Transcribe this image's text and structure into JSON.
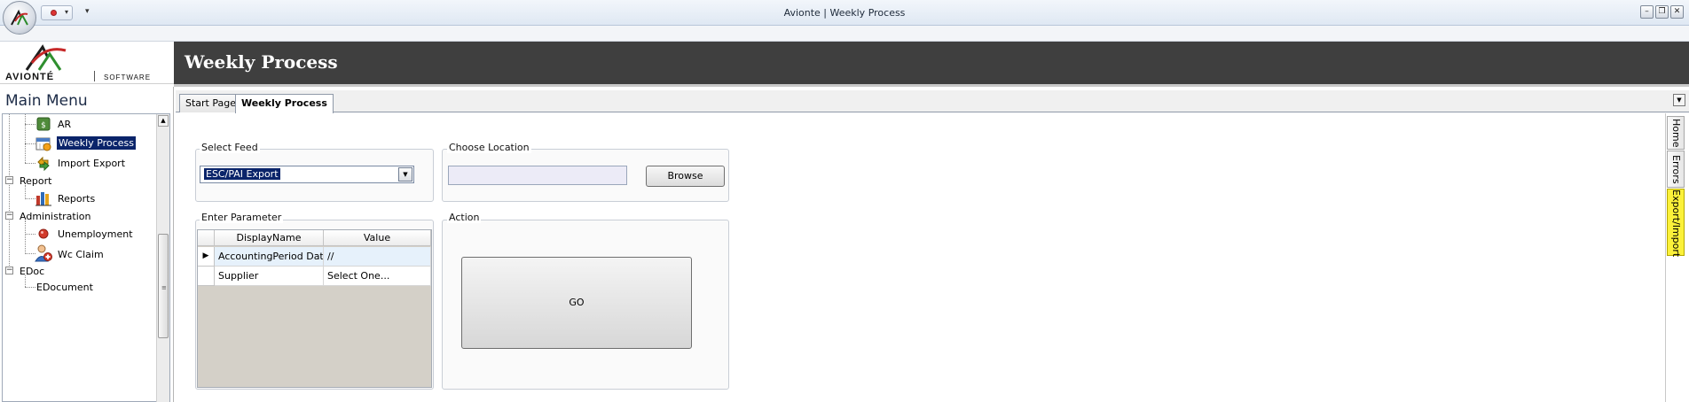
{
  "window": {
    "title": "Avionte | Weekly Process",
    "qat_more": "▾",
    "buttons": {
      "minimize": "–",
      "restore": "❐",
      "close": "✕"
    }
  },
  "brand": {
    "name": "AVIONTÉ",
    "sub": "SOFTWARE"
  },
  "header": {
    "title": "Weekly Process"
  },
  "main_menu": {
    "title": "Main Menu",
    "groups": [
      {
        "label": "Report",
        "expander": "−"
      },
      {
        "label": "Administration",
        "expander": "−"
      },
      {
        "label": "EDoc",
        "expander": "−"
      }
    ],
    "items": [
      {
        "label": "AR"
      },
      {
        "label": "Weekly Process",
        "selected": true
      },
      {
        "label": "Import Export"
      },
      {
        "label": "Reports"
      },
      {
        "label": "Unemployment"
      },
      {
        "label": "Wc Claim"
      },
      {
        "label": "EDocument"
      }
    ],
    "scroll_up": "▲",
    "scroll_grip": "≡"
  },
  "tabs": [
    {
      "label": "Start Page",
      "active": false
    },
    {
      "label": "Weekly Process",
      "active": true
    }
  ],
  "tab_menu_icon": "▼",
  "select_feed": {
    "title": "Select Feed",
    "value": "ESC/PAI Export",
    "dropdown_icon": "▼"
  },
  "choose_location": {
    "title": "Choose Location",
    "value": "",
    "browse_label": "Browse"
  },
  "enter_parameter": {
    "title": "Enter Parameter",
    "columns": [
      "DisplayName",
      "Value"
    ],
    "rows": [
      {
        "name": "AccountingPeriod Dat",
        "value": "//",
        "current": true
      },
      {
        "name": "Supplier",
        "value": "Select One...",
        "current": false
      }
    ],
    "row_marker": "▶"
  },
  "action": {
    "title": "Action",
    "go_label": "GO"
  },
  "side_tabs": [
    {
      "label": "Home",
      "active": false
    },
    {
      "label": "Errors",
      "active": false
    },
    {
      "label": "Export/Import",
      "active": true
    }
  ],
  "colors": {
    "header_bg": "#3f3f3f",
    "selection": "#0a246a",
    "active_side_tab": "#fbf13a"
  }
}
